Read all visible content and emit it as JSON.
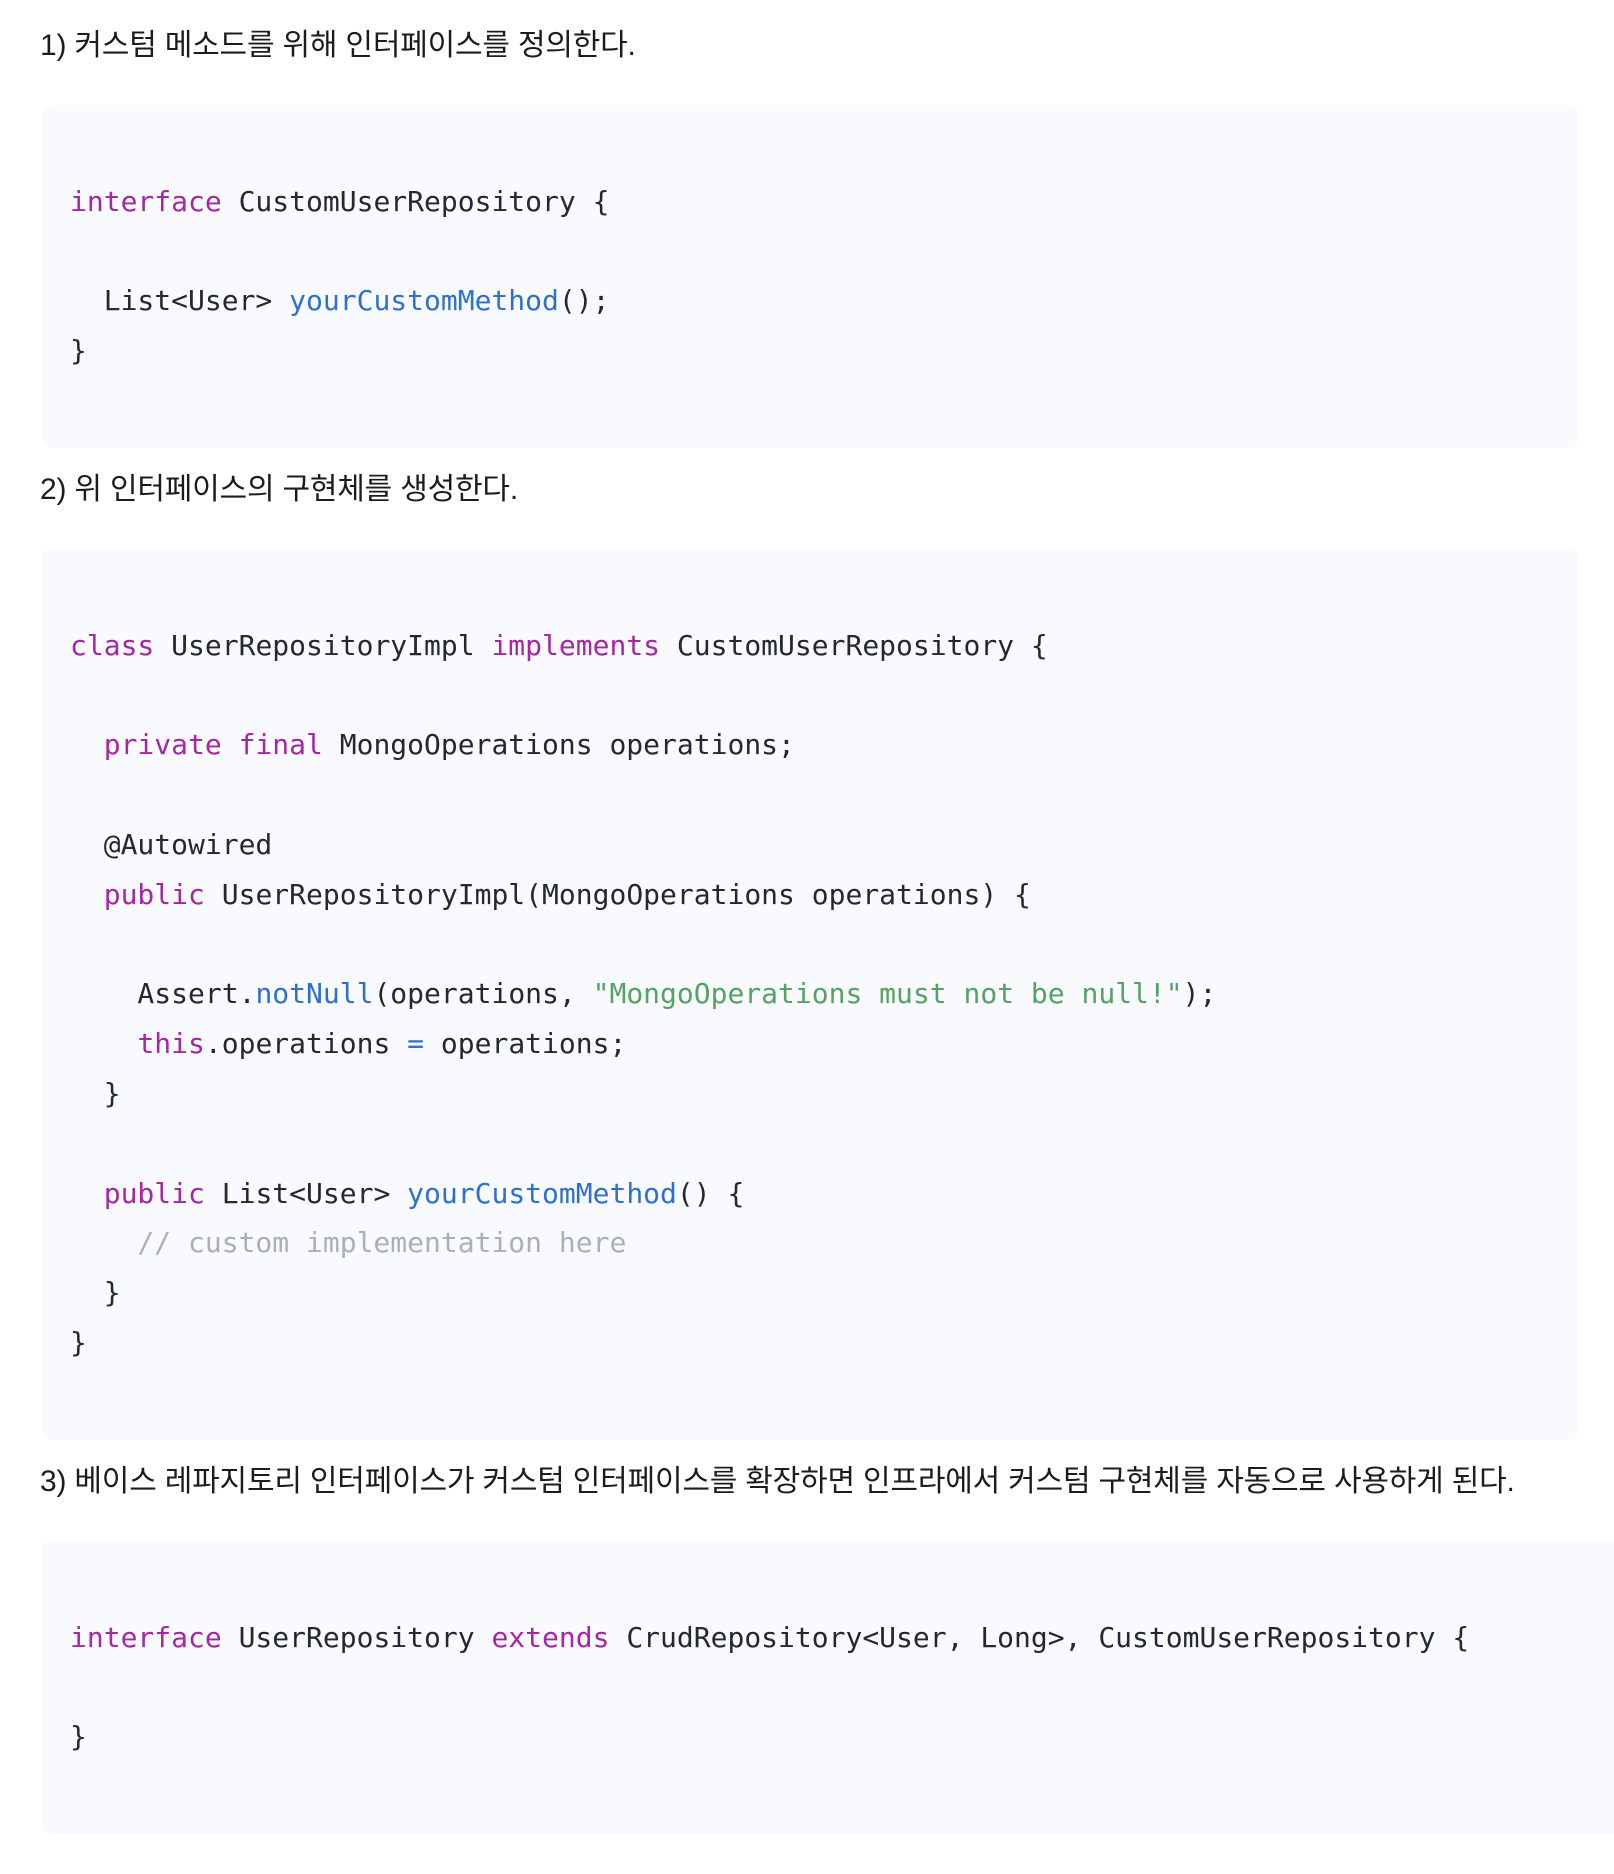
{
  "document": {
    "language": "ko",
    "sections": [
      {
        "id": "step-1",
        "paragraph": "1) 커스텀 메소드를 위해 인터페이스를 정의한다.",
        "code_language": "java",
        "code_lines": [
          [
            {
              "t": "interface ",
              "c": "kw"
            },
            {
              "t": "CustomUserRepository {",
              "c": "txt"
            }
          ],
          [
            {
              "t": "",
              "c": "txt"
            }
          ],
          [
            {
              "t": "  List<User> ",
              "c": "txt"
            },
            {
              "t": "yourCustomMethod",
              "c": "fn"
            },
            {
              "t": "();",
              "c": "txt"
            }
          ],
          [
            {
              "t": "}",
              "c": "txt"
            }
          ]
        ]
      },
      {
        "id": "step-2",
        "paragraph": "2) 위 인터페이스의 구현체를 생성한다.",
        "code_language": "java",
        "code_lines": [
          [
            {
              "t": "class ",
              "c": "kw"
            },
            {
              "t": "UserRepositoryImpl ",
              "c": "txt"
            },
            {
              "t": "implements ",
              "c": "kw"
            },
            {
              "t": "CustomUserRepository {",
              "c": "txt"
            }
          ],
          [
            {
              "t": "",
              "c": "txt"
            }
          ],
          [
            {
              "t": "  ",
              "c": "txt"
            },
            {
              "t": "private final ",
              "c": "kw"
            },
            {
              "t": "MongoOperations operations;",
              "c": "txt"
            }
          ],
          [
            {
              "t": "",
              "c": "txt"
            }
          ],
          [
            {
              "t": "  @Autowired",
              "c": "txt"
            }
          ],
          [
            {
              "t": "  ",
              "c": "txt"
            },
            {
              "t": "public ",
              "c": "kw"
            },
            {
              "t": "UserRepositoryImpl(MongoOperations operations) {",
              "c": "txt"
            }
          ],
          [
            {
              "t": "",
              "c": "txt"
            }
          ],
          [
            {
              "t": "    Assert.",
              "c": "txt"
            },
            {
              "t": "notNull",
              "c": "fn"
            },
            {
              "t": "(operations, ",
              "c": "txt"
            },
            {
              "t": "\"MongoOperations must not be null!\"",
              "c": "str"
            },
            {
              "t": ");",
              "c": "txt"
            }
          ],
          [
            {
              "t": "    ",
              "c": "txt"
            },
            {
              "t": "this",
              "c": "kw"
            },
            {
              "t": ".operations ",
              "c": "txt"
            },
            {
              "t": "=",
              "c": "op"
            },
            {
              "t": " operations;",
              "c": "txt"
            }
          ],
          [
            {
              "t": "  }",
              "c": "txt"
            }
          ],
          [
            {
              "t": "",
              "c": "txt"
            }
          ],
          [
            {
              "t": "  ",
              "c": "txt"
            },
            {
              "t": "public ",
              "c": "kw"
            },
            {
              "t": "List<User> ",
              "c": "txt"
            },
            {
              "t": "yourCustomMethod",
              "c": "fn"
            },
            {
              "t": "() {",
              "c": "txt"
            }
          ],
          [
            {
              "t": "    // custom implementation here",
              "c": "cmt"
            }
          ],
          [
            {
              "t": "  }",
              "c": "txt"
            }
          ],
          [
            {
              "t": "}",
              "c": "txt"
            }
          ]
        ]
      },
      {
        "id": "step-3",
        "paragraph": "3) 베이스 레파지토리 인터페이스가 커스텀 인터페이스를 확장하면 인프라에서 커스텀 구현체를 자동으로 사용하게 된다.",
        "code_language": "java",
        "code_lines": [
          [
            {
              "t": "interface ",
              "c": "kw"
            },
            {
              "t": "UserRepository ",
              "c": "txt"
            },
            {
              "t": "extends ",
              "c": "kw"
            },
            {
              "t": "CrudRepository<User, Long>, CustomUserRepository {",
              "c": "txt"
            }
          ],
          [
            {
              "t": "",
              "c": "txt"
            }
          ],
          [
            {
              "t": "}",
              "c": "txt"
            }
          ]
        ]
      }
    ]
  },
  "theme": {
    "page_background": "#ffffff",
    "code_background": "#f9fafd",
    "text_color": "#1c1c1e",
    "code_text_color": "#24292e",
    "keyword_color": "#a626a4",
    "function_color": "#2f6fd0",
    "operator_color": "#2f6fd0",
    "string_color": "#55a362",
    "comment_color": "#a9b0b8"
  }
}
